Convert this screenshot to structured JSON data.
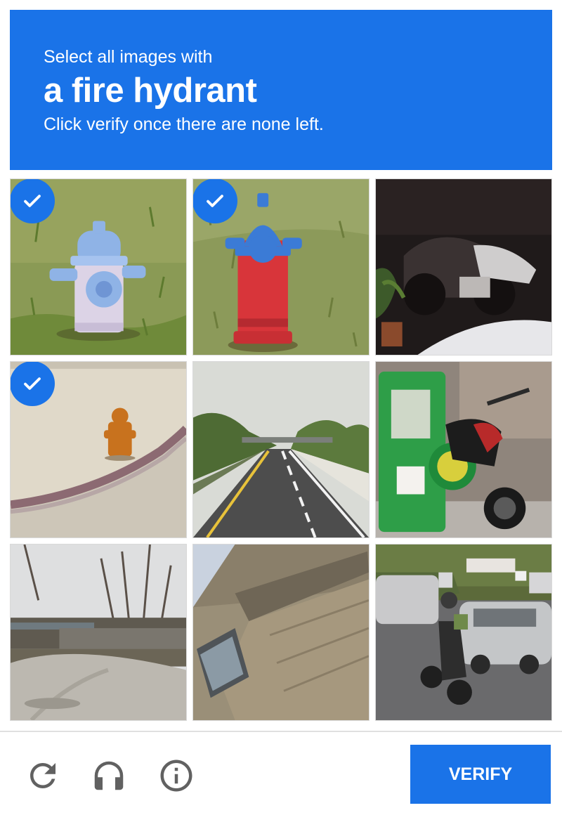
{
  "header": {
    "line1": "Select all images with",
    "target": "a fire hydrant",
    "line3": "Click verify once there are none left."
  },
  "tiles": [
    {
      "scene": "light blue and white fire hydrant on grass",
      "selected": true
    },
    {
      "scene": "red fire hydrant with blue cap on grass",
      "selected": true
    },
    {
      "scene": "motorcycles parked in a dark garage with plants",
      "selected": false
    },
    {
      "scene": "orange fire hydrant on a sidewalk corner",
      "selected": true
    },
    {
      "scene": "highway road with green hills and an overpass",
      "selected": false
    },
    {
      "scene": "green tricycle with motorcycle parked on street",
      "selected": false
    },
    {
      "scene": "concrete path near a bridge with bare trees",
      "selected": false
    },
    {
      "scene": "angled view of a concrete building wall",
      "selected": false
    },
    {
      "scene": "motorcyclist riding beside cars on a road",
      "selected": false
    }
  ],
  "footer": {
    "reload_icon": "reload-icon",
    "audio_icon": "headphones-icon",
    "info_icon": "info-icon",
    "verify_label": "VERIFY"
  },
  "colors": {
    "accent": "#1a73e8",
    "icon_gray": "#616161",
    "divider": "#e0e0e0"
  }
}
